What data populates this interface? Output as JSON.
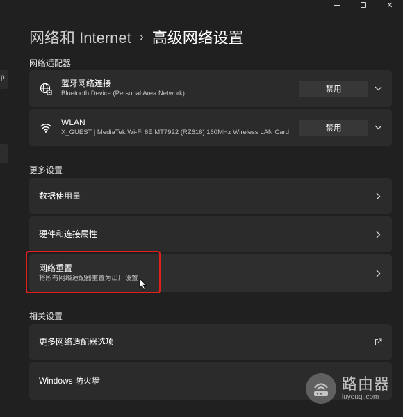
{
  "window_controls": {
    "minimize": "—",
    "maximize": "□",
    "close": "✕"
  },
  "sidebar": {
    "partial_glyph": "p"
  },
  "breadcrumb": {
    "parent": "网络和 Internet",
    "separator": "›",
    "current": "高级网络设置"
  },
  "adapters": {
    "heading": "网络适配器",
    "items": [
      {
        "icon": "ethernet-globe-icon",
        "name": "蓝牙网络连接",
        "description": "Bluetooth Device (Personal Area Network)",
        "button": "禁用"
      },
      {
        "icon": "wifi-icon",
        "name": "WLAN",
        "description": "X_GUEST | MediaTek Wi-Fi 6E MT7922 (RZ616) 160MHz Wireless LAN Card",
        "button": "禁用"
      }
    ]
  },
  "more_settings": {
    "heading": "更多设置",
    "items": [
      {
        "title": "数据使用量"
      },
      {
        "title": "硬件和连接属性"
      },
      {
        "title": "网络重置",
        "subtitle": "将所有网络适配器重置为出厂设置"
      }
    ]
  },
  "related_settings": {
    "heading": "相关设置",
    "items": [
      {
        "title": "更多网络适配器选项",
        "action_icon": "open-external-icon"
      },
      {
        "title": "Windows 防火墙"
      }
    ]
  },
  "highlight_color": "#e0201e",
  "watermark": {
    "chinese": "路由器",
    "latin": "luyouqi.com"
  }
}
